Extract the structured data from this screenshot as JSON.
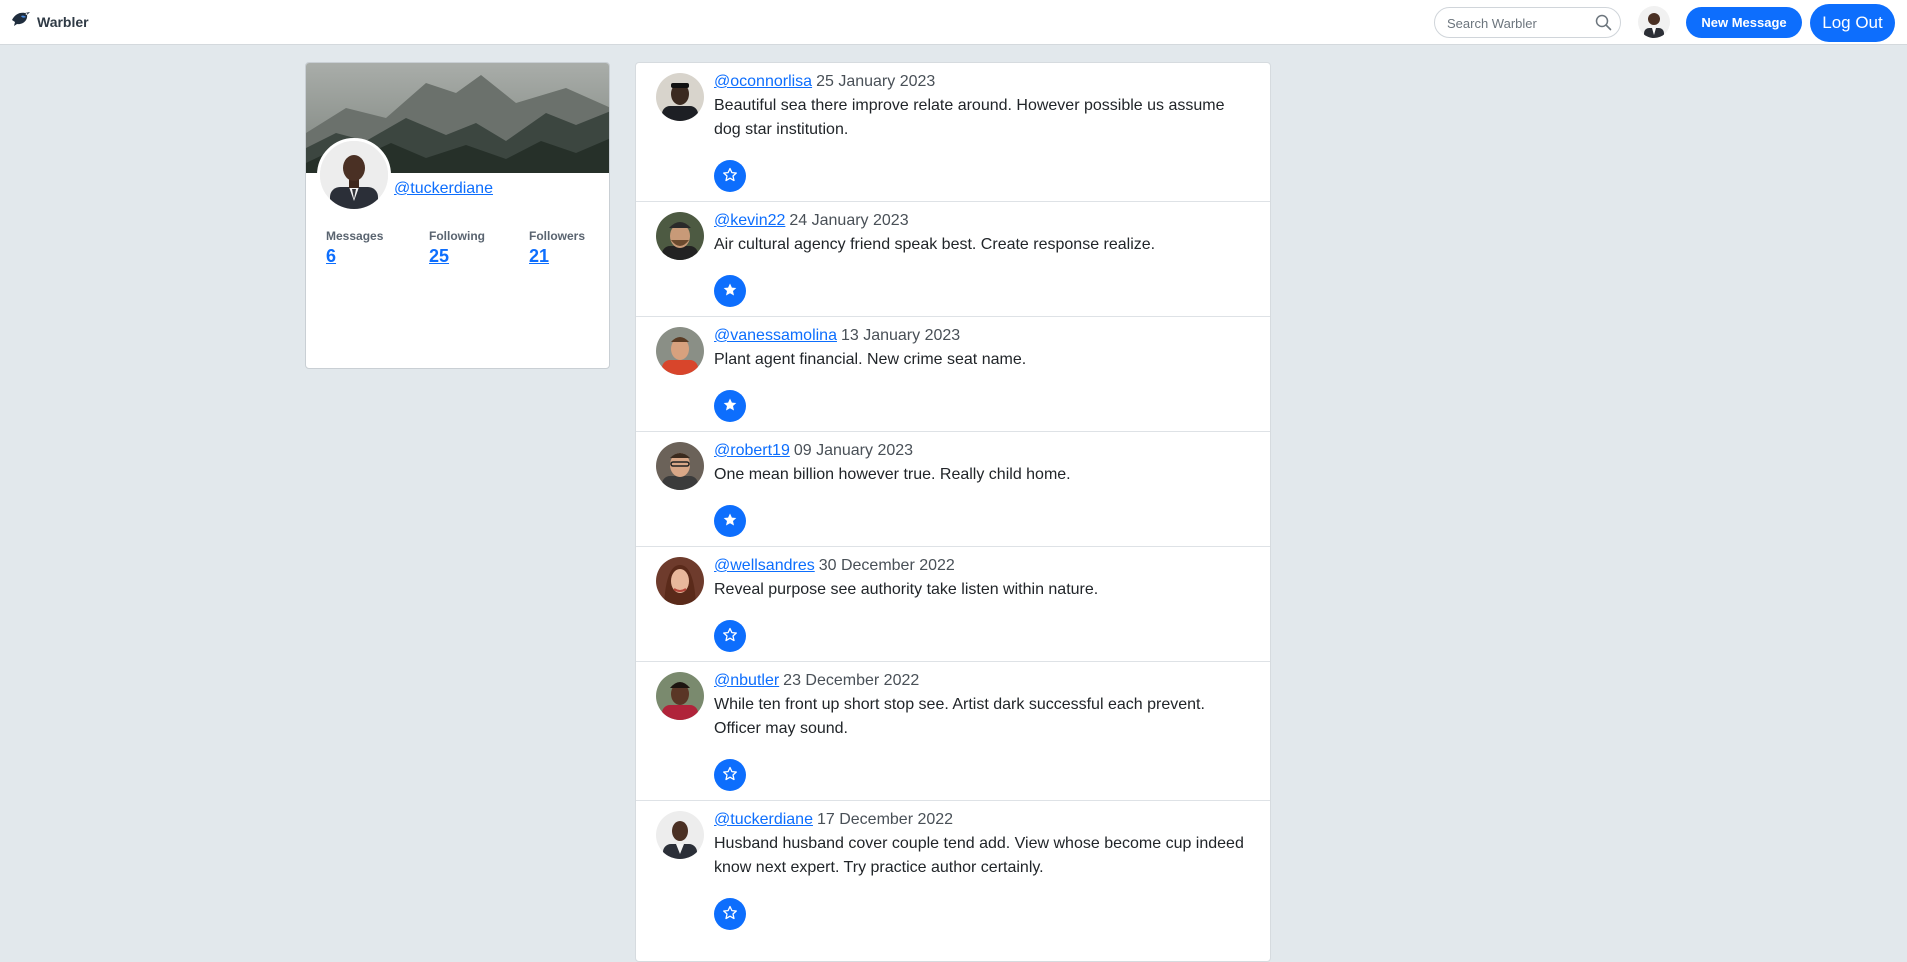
{
  "navbar": {
    "brand": "Warbler",
    "search_placeholder": "Search Warbler",
    "new_message_label": "New Message",
    "logout_label": "Log Out"
  },
  "profile": {
    "handle": "@tuckerdiane",
    "stats": [
      {
        "label": "Messages",
        "value": "6"
      },
      {
        "label": "Following",
        "value": "25"
      },
      {
        "label": "Followers",
        "value": "21"
      }
    ]
  },
  "messages": [
    {
      "user": "@oconnorlisa",
      "date": "25 January 2023",
      "text": "Beautiful sea there improve relate around. However possible us assume dog star institution.",
      "liked": false
    },
    {
      "user": "@kevin22",
      "date": "24 January 2023",
      "text": "Air cultural agency friend speak best. Create response realize.",
      "liked": true
    },
    {
      "user": "@vanessamolina",
      "date": "13 January 2023",
      "text": "Plant agent financial. New crime seat name.",
      "liked": true
    },
    {
      "user": "@robert19",
      "date": "09 January 2023",
      "text": "One mean billion however true. Really child home.",
      "liked": true
    },
    {
      "user": "@wellsandres",
      "date": "30 December 2022",
      "text": "Reveal purpose see authority take listen within nature.",
      "liked": false
    },
    {
      "user": "@nbutler",
      "date": "23 December 2022",
      "text": "While ten front up short stop see. Artist dark successful each prevent. Officer may sound.",
      "liked": false
    },
    {
      "user": "@tuckerdiane",
      "date": "17 December 2022",
      "text": "Husband husband cover couple tend add. View whose become cup indeed know next expert. Try practice author certainly.",
      "liked": false
    }
  ],
  "colors": {
    "accent": "#0d6efd",
    "page_background": "#e2e8ec"
  }
}
